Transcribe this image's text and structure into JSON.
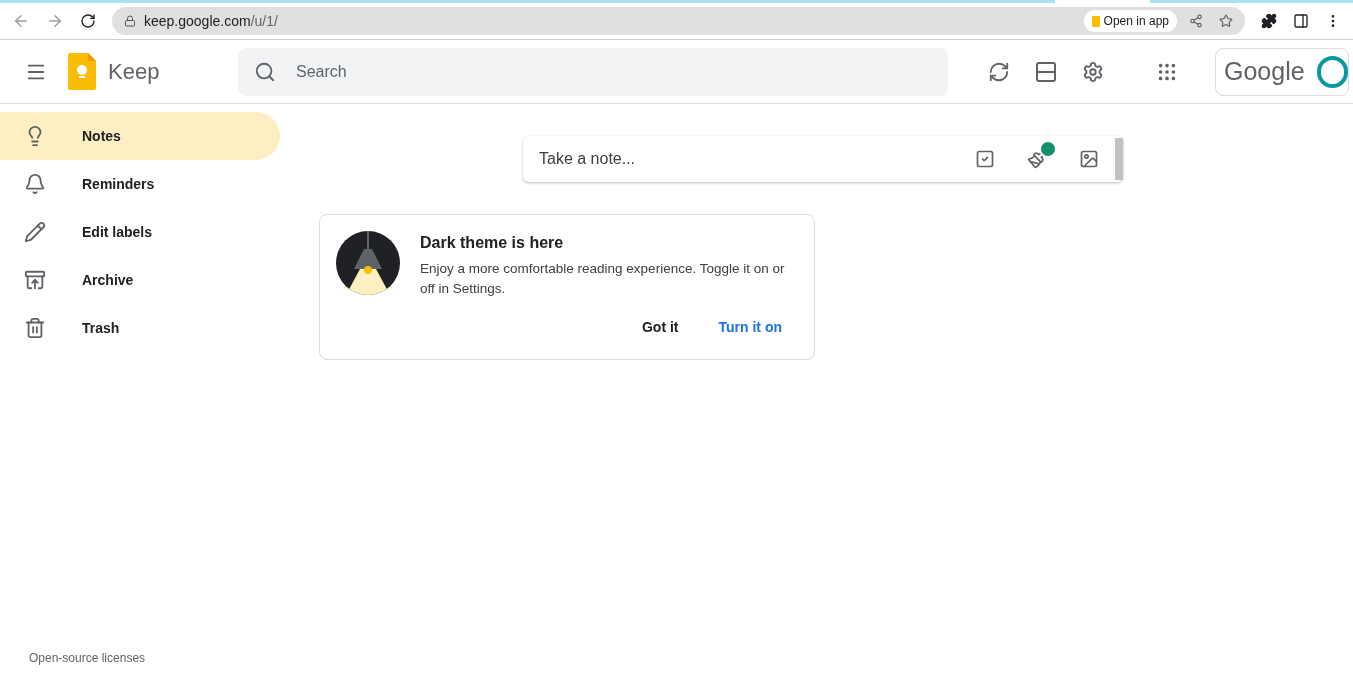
{
  "browser": {
    "url_host": "keep.google.com",
    "url_path": "/u/1/",
    "open_in_app": "Open in app"
  },
  "header": {
    "app_name": "Keep",
    "search": {
      "placeholder": "Search"
    },
    "account_brand": "Google"
  },
  "sidebar": {
    "items": [
      {
        "label": "Notes",
        "selected": true
      },
      {
        "label": "Reminders",
        "selected": false
      },
      {
        "label": "Edit labels",
        "selected": false
      },
      {
        "label": "Archive",
        "selected": false
      },
      {
        "label": "Trash",
        "selected": false
      }
    ],
    "footer_link": "Open-source licenses"
  },
  "note_input": {
    "placeholder": "Take a note..."
  },
  "promo_card": {
    "title": "Dark theme is here",
    "body": "Enjoy a more comfortable reading experience. Toggle it on or off in Settings.",
    "buttons": [
      {
        "label": "Got it",
        "kind": "plain"
      },
      {
        "label": "Turn it on",
        "kind": "primary"
      }
    ]
  }
}
